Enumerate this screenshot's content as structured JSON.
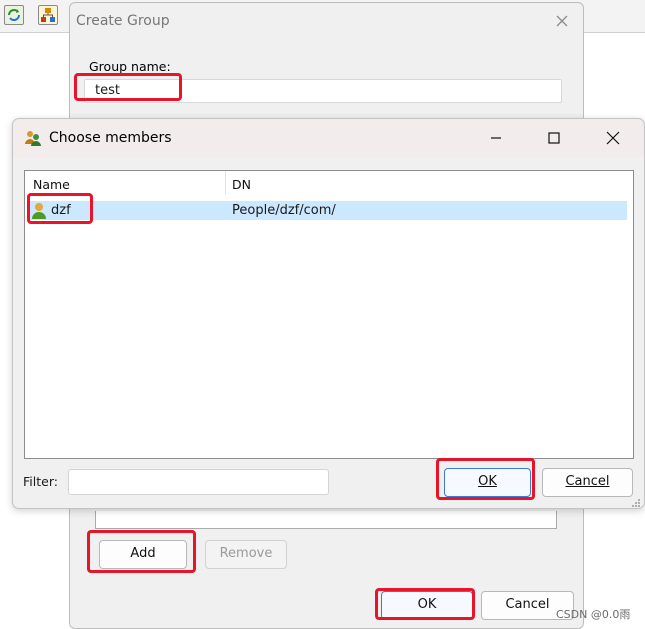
{
  "toolbar": {
    "icons": [
      "refresh-icon",
      "network-icon"
    ]
  },
  "create_group": {
    "title": "Create Group",
    "group_name_label": "Group name:",
    "group_name_value": "test",
    "add_label": "Add",
    "remove_label": "Remove",
    "ok_label": "OK",
    "cancel_label": "Cancel"
  },
  "choose_members": {
    "title": "Choose members",
    "columns": [
      "Name",
      "DN"
    ],
    "rows": [
      {
        "name": "dzf",
        "dn": "People/dzf/com/",
        "selected": true
      }
    ],
    "filter_label": "Filter:",
    "filter_value": "",
    "ok_label": "OK",
    "cancel_label": "Cancel",
    "selection_color": "#cce8ff"
  },
  "annotation_color": "#e8142a",
  "watermark": "CSDN @0.0雨"
}
